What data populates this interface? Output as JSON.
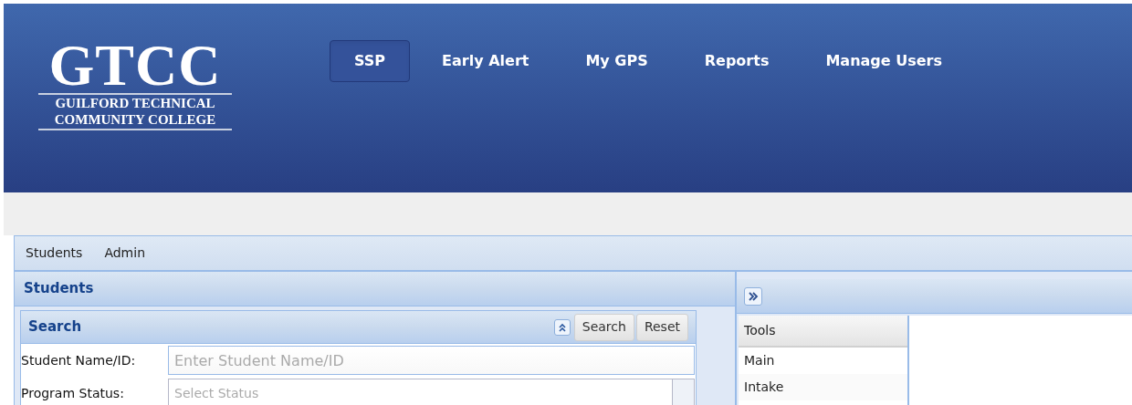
{
  "logo": {
    "initials": "GTCC",
    "line_1": "GUILFORD TECHNICAL",
    "line_2": "COMMUNITY COLLEGE"
  },
  "nav": [
    {
      "label": "SSP",
      "selected": true
    },
    {
      "label": "Early Alert",
      "selected": false
    },
    {
      "label": "My GPS",
      "selected": false
    },
    {
      "label": "Reports",
      "selected": false
    },
    {
      "label": "Manage Users",
      "selected": false
    }
  ],
  "menu": [
    "Students",
    "Admin"
  ],
  "students_panel": {
    "title": "Students",
    "search": {
      "title": "Search",
      "buttons": [
        "Search",
        "Reset"
      ],
      "fields": [
        {
          "kind": "text",
          "label": "Student Name/ID:",
          "placeholder": "Enter Student Name/ID"
        },
        {
          "kind": "combo",
          "label": "Program Status:",
          "placeholder": "Select Status"
        }
      ]
    }
  },
  "tools_panel": {
    "header": "Tools",
    "items": [
      {
        "label": "Main",
        "selected": false
      },
      {
        "label": "Intake",
        "selected": false
      }
    ]
  }
}
